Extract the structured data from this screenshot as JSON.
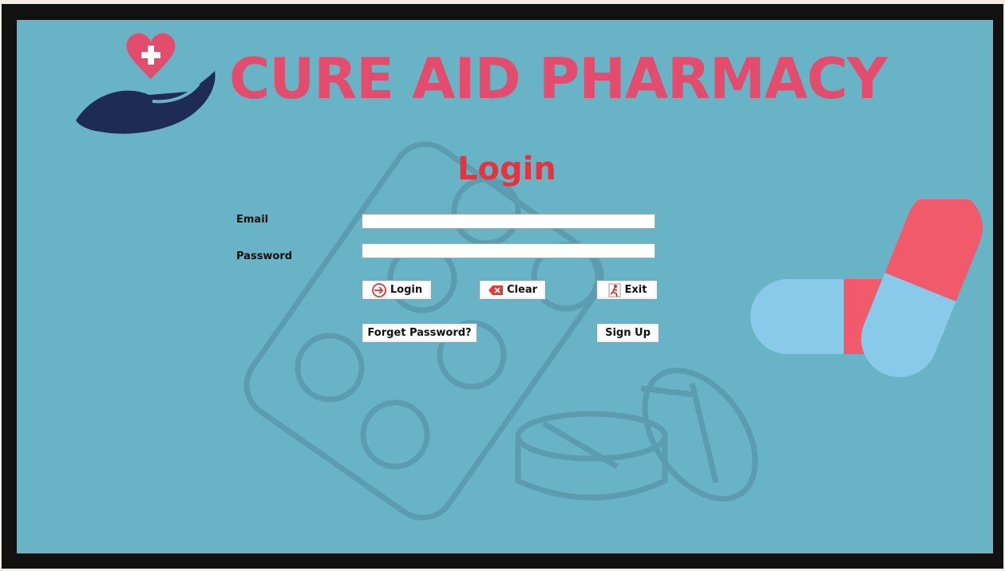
{
  "app": {
    "brand": "CURE AID PHARMACY"
  },
  "login_form": {
    "title": "Login",
    "email_label": "Email",
    "email_value": "",
    "password_label": "Password",
    "password_value": "",
    "login_button": "Login",
    "clear_button": "Clear",
    "exit_button": "Exit",
    "forget_password_button": "Forget Password?",
    "signup_button": "Sign Up"
  },
  "icons": {
    "logo": "heart-hand-icon",
    "login": "login-arrow-icon",
    "clear": "backspace-clear-icon",
    "exit": "exit-runner-icon",
    "background": "pill-blister-icon",
    "decor": "capsule-icon"
  },
  "colors": {
    "background": "#68b3c5",
    "brand": "#e44c6d",
    "title": "#e5343f",
    "logo_hand": "#1d2b55",
    "capsule_red": "#f05a6a",
    "capsule_blue": "#89c9ea"
  }
}
